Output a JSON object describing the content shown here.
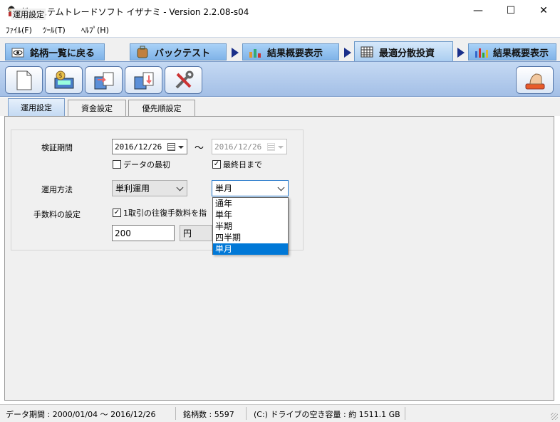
{
  "window": {
    "title": "株システムトレードソフト イザナミ - Version 2.2.08-s04",
    "minimize": "—",
    "maximize": "☐",
    "close": "✕"
  },
  "menu": [
    {
      "label": "ﾌｧｲﾙ(F)"
    },
    {
      "label": "ﾂｰﾙ(T)"
    },
    {
      "label": "ﾍﾙﾌﾟ(H)"
    }
  ],
  "nav_tabs": [
    {
      "label": "銘柄一覧に戻る"
    },
    {
      "label": "バックテスト"
    },
    {
      "label": "結果概要表示"
    },
    {
      "label": "最適分散投資"
    },
    {
      "label": "結果概要表示"
    }
  ],
  "sub_tabs": [
    {
      "label": "運用設定"
    },
    {
      "label": "資金設定"
    },
    {
      "label": "優先順設定"
    }
  ],
  "settings": {
    "group_title": "運用設定",
    "period_label": "検証期間",
    "start_date": "2016/12/26",
    "tilde": "〜",
    "end_date": "2016/12/26",
    "from_first_label": "データの最初",
    "from_first_checked": false,
    "to_last_label": "最終日まで",
    "to_last_checked": true,
    "method_label": "運用方法",
    "method_value": "単利運用",
    "period_select_value": "単月",
    "fee_label": "手数料の設定",
    "fee_check_label": "1取引の往復手数料を指",
    "fee_checked": true,
    "fee_amount": "200",
    "fee_unit": "円"
  },
  "period_dropdown": {
    "options": [
      "通年",
      "単年",
      "半期",
      "四半期",
      "単月"
    ],
    "selected_index": 4
  },
  "status_bar": {
    "data_period": "データ期間 : 2000/01/04 〜 2016/12/26",
    "stock_count": "銘柄数 : 5597",
    "drive_space": "(C:) ドライブの空き容量 : 約 1511.1 GB"
  },
  "colors": {
    "accent": "#0078d7",
    "nav_tab": "#8fc0ee",
    "toolbar": "#b4cdec",
    "nav_arrow": "#1a2f8a"
  }
}
